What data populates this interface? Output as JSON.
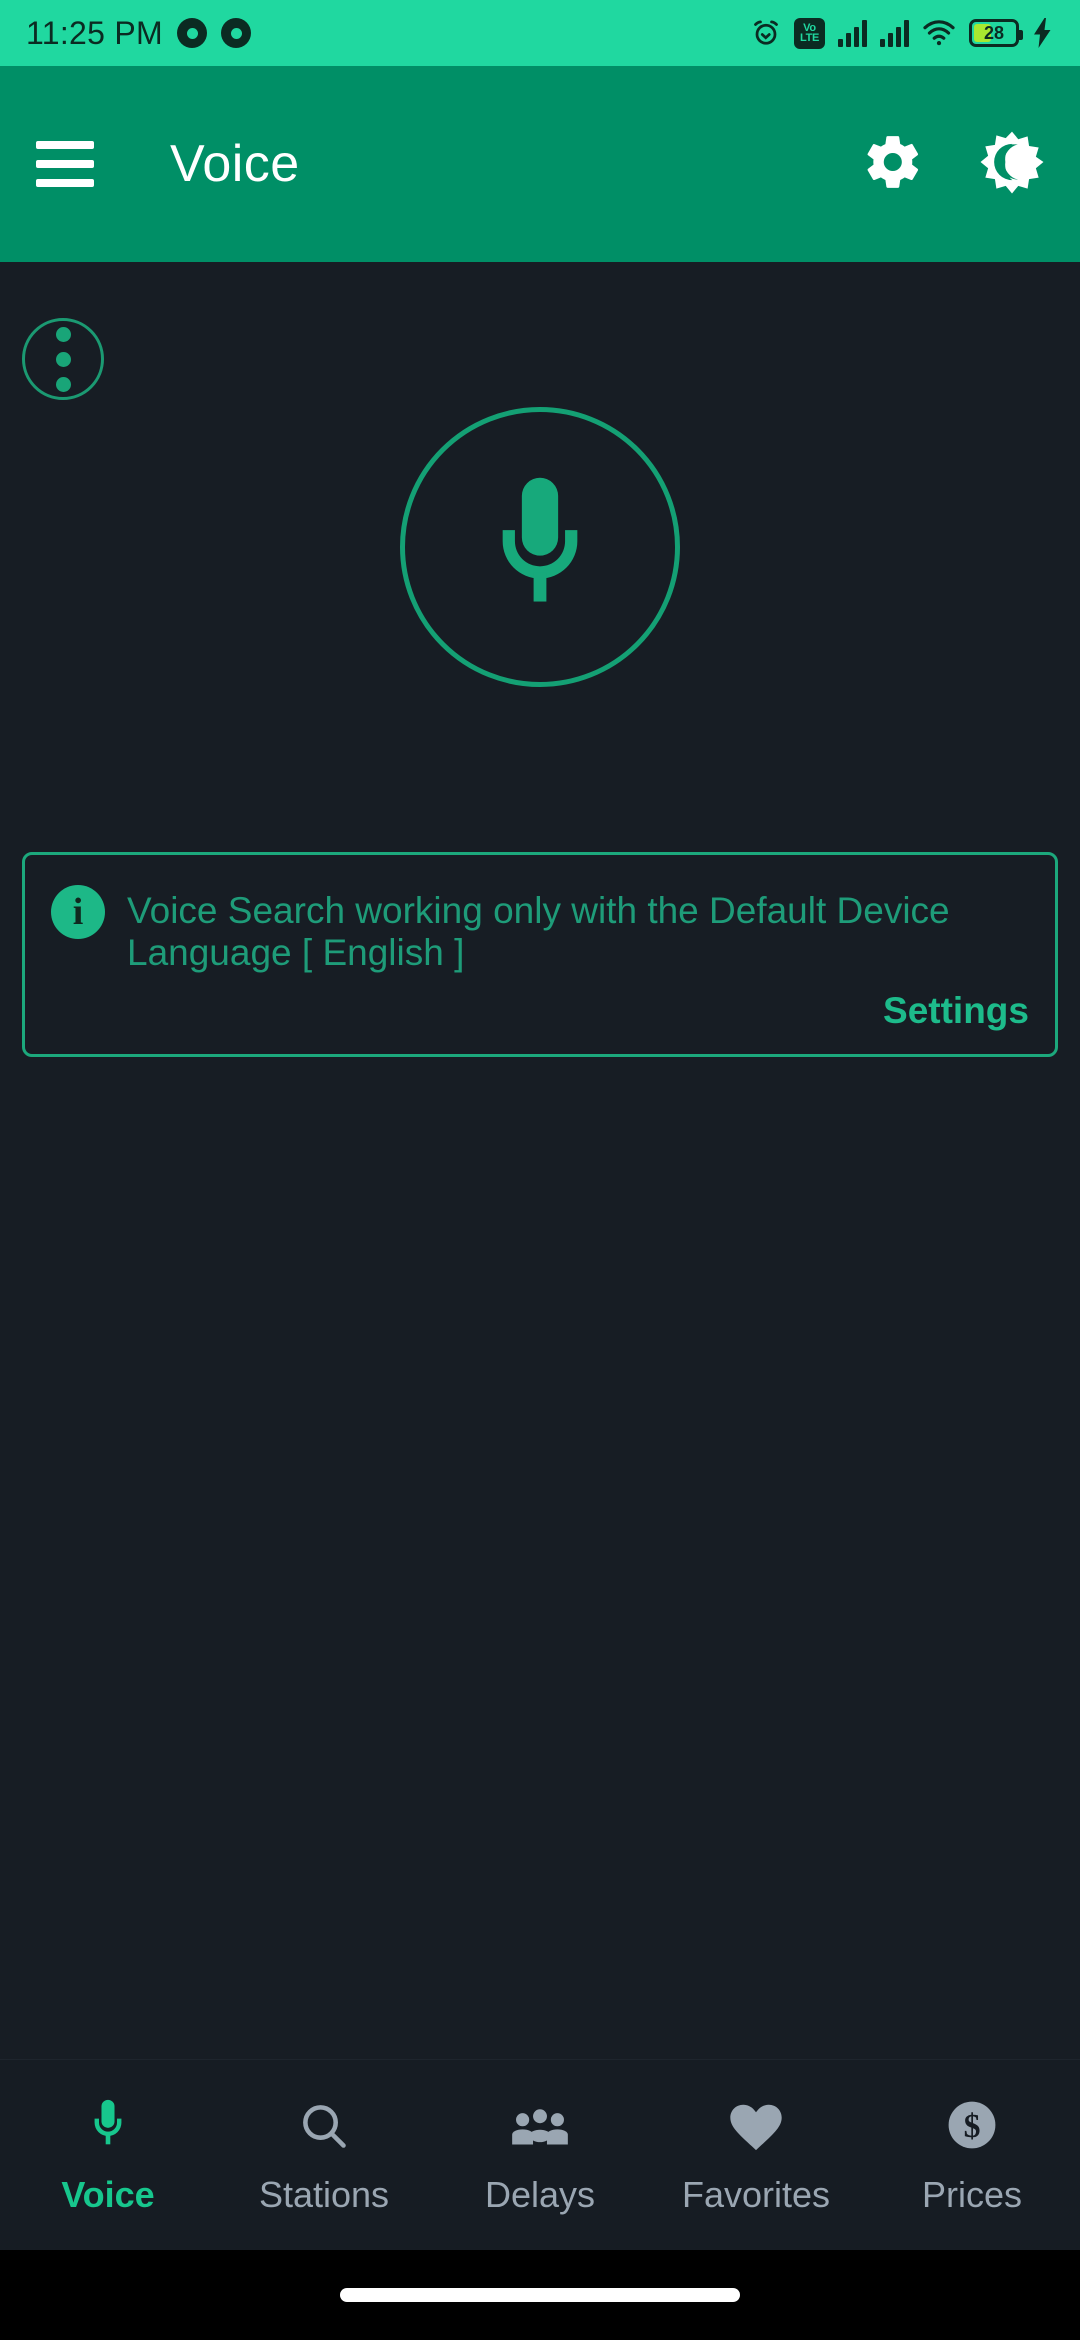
{
  "statusbar": {
    "time": "11:25 PM",
    "notification_icons": [
      "notification-dot-icon",
      "notification-dot-icon"
    ],
    "alarm_icon": "alarm-clock-icon",
    "volte_top": "Vo",
    "volte_bottom": "LTE",
    "signal_icons": [
      "signal-bars-icon",
      "signal-bars-icon"
    ],
    "wifi_icon": "wifi-icon",
    "battery_level": "28",
    "charging_icon": "charging-bolt-icon",
    "background_color": "#20D8A0",
    "foreground_color": "#0B2B22"
  },
  "appbar": {
    "menu_icon": "hamburger-menu-icon",
    "title": "Voice",
    "settings_icon": "gear-icon",
    "theme_icon": "brightness-dark-mode-icon",
    "background_color": "#008F66",
    "text_color": "#FFFFFF"
  },
  "main": {
    "overflow_icon": "more-vertical-icon",
    "mic_icon": "microphone-icon",
    "accent_color": "#14A074",
    "background_color": "#171D24"
  },
  "info_card": {
    "icon": "info-icon",
    "message": "Voice Search working only with the Default Device Language [ English ]",
    "settings_link": "Settings",
    "border_color": "#1CA87C",
    "text_color": "#1E9C79"
  },
  "bottom_nav": {
    "active_color": "#17C78D",
    "inactive_color": "#9AA6B2",
    "items": [
      {
        "label": "Voice",
        "icon": "microphone-icon",
        "active": true
      },
      {
        "label": "Stations",
        "icon": "search-icon",
        "active": false
      },
      {
        "label": "Delays",
        "icon": "people-group-icon",
        "active": false
      },
      {
        "label": "Favorites",
        "icon": "heart-icon",
        "active": false
      },
      {
        "label": "Prices",
        "icon": "dollar-circle-icon",
        "active": false
      }
    ]
  },
  "gesture_bar": {
    "handle": "home-gesture-pill"
  }
}
